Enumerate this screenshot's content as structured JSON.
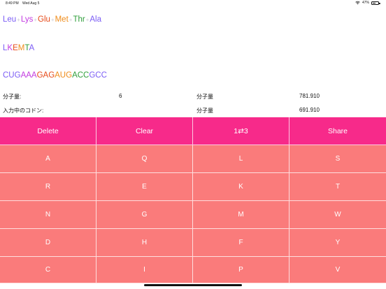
{
  "status_bar": {
    "time": "8:49 PM",
    "date": "Wed Aug 5",
    "battery": "47%",
    "battery_level": 0.47
  },
  "sequence_three_letter": [
    {
      "text": "Leu",
      "color": "#7b5cf5"
    },
    {
      "text": "Lys",
      "color": "#c23be0"
    },
    {
      "text": "Glu",
      "color": "#e64a19"
    },
    {
      "text": "Met",
      "color": "#ef8c1a"
    },
    {
      "text": "Thr",
      "color": "#2e9e3a"
    },
    {
      "text": "Ala",
      "color": "#7b5cf5"
    }
  ],
  "sequence_separator": "+",
  "sequence_separator_color": "#c9c9d0",
  "sequence_one_letter": [
    {
      "text": "L",
      "color": "#7b5cf5"
    },
    {
      "text": "K",
      "color": "#c23be0"
    },
    {
      "text": "E",
      "color": "#e64a19"
    },
    {
      "text": "M",
      "color": "#ef8c1a"
    },
    {
      "text": "T",
      "color": "#2e9e3a"
    },
    {
      "text": "A",
      "color": "#7b5cf5"
    }
  ],
  "sequence_codons": [
    {
      "text": "CUG",
      "color": "#7b5cf5"
    },
    {
      "text": "AAA",
      "color": "#c23be0"
    },
    {
      "text": "GAG",
      "color": "#e64a19"
    },
    {
      "text": "AUG",
      "color": "#ef8c1a"
    },
    {
      "text": "ACC",
      "color": "#2e9e3a"
    },
    {
      "text": "GCC",
      "color": "#7b5cf5"
    }
  ],
  "info": {
    "count_label": "分子量:",
    "count_value": "6",
    "mw_label_1": "分子量",
    "mw_value_1": "781.910",
    "input_codon_label": "入力中のコドン:",
    "mw_label_2": "分子量",
    "mw_value_2": "691.910"
  },
  "actions": [
    {
      "name": "delete-button",
      "label": "Delete"
    },
    {
      "name": "clear-button",
      "label": "Clear"
    },
    {
      "name": "toggle-1-3-button",
      "label": "1⇄3"
    },
    {
      "name": "share-button",
      "label": "Share"
    }
  ],
  "keys": [
    [
      "A",
      "Q",
      "L",
      "S"
    ],
    [
      "R",
      "E",
      "K",
      "T"
    ],
    [
      "N",
      "G",
      "M",
      "W"
    ],
    [
      "D",
      "H",
      "F",
      "Y"
    ],
    [
      "C",
      "I",
      "P",
      "V"
    ]
  ],
  "colors": {
    "action_bg": "#f72a8a",
    "key_bg": "#fa7b7b"
  }
}
